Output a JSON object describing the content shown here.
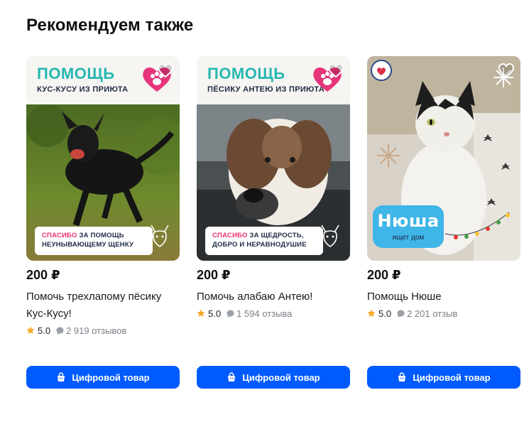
{
  "section": {
    "title": "Рекомендуем также"
  },
  "cards": [
    {
      "banner_big": "ПОМОЩЬ",
      "banner_small": "КУС-КУСУ ИЗ ПРИЮТА",
      "thanks_red": "СПАСИБО",
      "thanks_rest": " ЗА ПОМОЩЬ",
      "thanks_line2": "НЕУНЫВАЮЩЕМУ ЩЕНКУ",
      "price": "200 ₽",
      "title": "Помочь трехлапому пёсику Кус-Кусу!",
      "rating": "5.0",
      "reviews": "2 919 отзывов",
      "button": "Цифровой товар"
    },
    {
      "banner_big": "ПОМОЩЬ",
      "banner_small": "ПЁСИКУ АНТЕЮ ИЗ ПРИЮТА",
      "thanks_red": "СПАСИБО",
      "thanks_rest": " ЗА ЩЕДРОСТЬ,",
      "thanks_line2": "ДОБРО И НЕРАВНОДУШИЕ",
      "price": "200 ₽",
      "title": "Помочь алабаю Антею!",
      "rating": "5.0",
      "reviews": "1 594 отзыва",
      "button": "Цифровой товар"
    },
    {
      "photo_title": "Нюша",
      "photo_subtitle": "ищет дом",
      "price": "200 ₽",
      "title": "Помощь Нюше",
      "rating": "5.0",
      "reviews": "2 201 отзыв",
      "button": "Цифровой товар"
    }
  ],
  "colors": {
    "button": "#005bff",
    "banner_accent": "#26b7b0",
    "star": "#f9a825"
  }
}
